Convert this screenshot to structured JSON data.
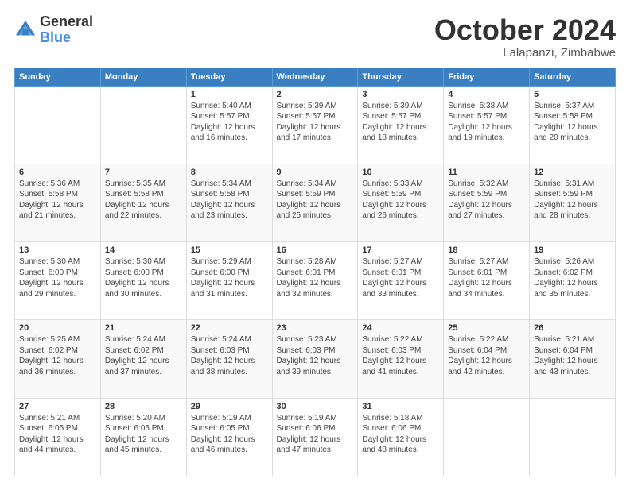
{
  "header": {
    "logo": {
      "line1": "General",
      "line2": "Blue"
    },
    "title": "October 2024",
    "location": "Lalapanzi, Zimbabwe"
  },
  "weekdays": [
    "Sunday",
    "Monday",
    "Tuesday",
    "Wednesday",
    "Thursday",
    "Friday",
    "Saturday"
  ],
  "weeks": [
    [
      {
        "day": null,
        "sunrise": null,
        "sunset": null,
        "daylight": null
      },
      {
        "day": null,
        "sunrise": null,
        "sunset": null,
        "daylight": null
      },
      {
        "day": "1",
        "sunrise": "Sunrise: 5:40 AM",
        "sunset": "Sunset: 5:57 PM",
        "daylight": "Daylight: 12 hours and 16 minutes."
      },
      {
        "day": "2",
        "sunrise": "Sunrise: 5:39 AM",
        "sunset": "Sunset: 5:57 PM",
        "daylight": "Daylight: 12 hours and 17 minutes."
      },
      {
        "day": "3",
        "sunrise": "Sunrise: 5:39 AM",
        "sunset": "Sunset: 5:57 PM",
        "daylight": "Daylight: 12 hours and 18 minutes."
      },
      {
        "day": "4",
        "sunrise": "Sunrise: 5:38 AM",
        "sunset": "Sunset: 5:57 PM",
        "daylight": "Daylight: 12 hours and 19 minutes."
      },
      {
        "day": "5",
        "sunrise": "Sunrise: 5:37 AM",
        "sunset": "Sunset: 5:58 PM",
        "daylight": "Daylight: 12 hours and 20 minutes."
      }
    ],
    [
      {
        "day": "6",
        "sunrise": "Sunrise: 5:36 AM",
        "sunset": "Sunset: 5:58 PM",
        "daylight": "Daylight: 12 hours and 21 minutes."
      },
      {
        "day": "7",
        "sunrise": "Sunrise: 5:35 AM",
        "sunset": "Sunset: 5:58 PM",
        "daylight": "Daylight: 12 hours and 22 minutes."
      },
      {
        "day": "8",
        "sunrise": "Sunrise: 5:34 AM",
        "sunset": "Sunset: 5:58 PM",
        "daylight": "Daylight: 12 hours and 23 minutes."
      },
      {
        "day": "9",
        "sunrise": "Sunrise: 5:34 AM",
        "sunset": "Sunset: 5:59 PM",
        "daylight": "Daylight: 12 hours and 25 minutes."
      },
      {
        "day": "10",
        "sunrise": "Sunrise: 5:33 AM",
        "sunset": "Sunset: 5:59 PM",
        "daylight": "Daylight: 12 hours and 26 minutes."
      },
      {
        "day": "11",
        "sunrise": "Sunrise: 5:32 AM",
        "sunset": "Sunset: 5:59 PM",
        "daylight": "Daylight: 12 hours and 27 minutes."
      },
      {
        "day": "12",
        "sunrise": "Sunrise: 5:31 AM",
        "sunset": "Sunset: 5:59 PM",
        "daylight": "Daylight: 12 hours and 28 minutes."
      }
    ],
    [
      {
        "day": "13",
        "sunrise": "Sunrise: 5:30 AM",
        "sunset": "Sunset: 6:00 PM",
        "daylight": "Daylight: 12 hours and 29 minutes."
      },
      {
        "day": "14",
        "sunrise": "Sunrise: 5:30 AM",
        "sunset": "Sunset: 6:00 PM",
        "daylight": "Daylight: 12 hours and 30 minutes."
      },
      {
        "day": "15",
        "sunrise": "Sunrise: 5:29 AM",
        "sunset": "Sunset: 6:00 PM",
        "daylight": "Daylight: 12 hours and 31 minutes."
      },
      {
        "day": "16",
        "sunrise": "Sunrise: 5:28 AM",
        "sunset": "Sunset: 6:01 PM",
        "daylight": "Daylight: 12 hours and 32 minutes."
      },
      {
        "day": "17",
        "sunrise": "Sunrise: 5:27 AM",
        "sunset": "Sunset: 6:01 PM",
        "daylight": "Daylight: 12 hours and 33 minutes."
      },
      {
        "day": "18",
        "sunrise": "Sunrise: 5:27 AM",
        "sunset": "Sunset: 6:01 PM",
        "daylight": "Daylight: 12 hours and 34 minutes."
      },
      {
        "day": "19",
        "sunrise": "Sunrise: 5:26 AM",
        "sunset": "Sunset: 6:02 PM",
        "daylight": "Daylight: 12 hours and 35 minutes."
      }
    ],
    [
      {
        "day": "20",
        "sunrise": "Sunrise: 5:25 AM",
        "sunset": "Sunset: 6:02 PM",
        "daylight": "Daylight: 12 hours and 36 minutes."
      },
      {
        "day": "21",
        "sunrise": "Sunrise: 5:24 AM",
        "sunset": "Sunset: 6:02 PM",
        "daylight": "Daylight: 12 hours and 37 minutes."
      },
      {
        "day": "22",
        "sunrise": "Sunrise: 5:24 AM",
        "sunset": "Sunset: 6:03 PM",
        "daylight": "Daylight: 12 hours and 38 minutes."
      },
      {
        "day": "23",
        "sunrise": "Sunrise: 5:23 AM",
        "sunset": "Sunset: 6:03 PM",
        "daylight": "Daylight: 12 hours and 39 minutes."
      },
      {
        "day": "24",
        "sunrise": "Sunrise: 5:22 AM",
        "sunset": "Sunset: 6:03 PM",
        "daylight": "Daylight: 12 hours and 41 minutes."
      },
      {
        "day": "25",
        "sunrise": "Sunrise: 5:22 AM",
        "sunset": "Sunset: 6:04 PM",
        "daylight": "Daylight: 12 hours and 42 minutes."
      },
      {
        "day": "26",
        "sunrise": "Sunrise: 5:21 AM",
        "sunset": "Sunset: 6:04 PM",
        "daylight": "Daylight: 12 hours and 43 minutes."
      }
    ],
    [
      {
        "day": "27",
        "sunrise": "Sunrise: 5:21 AM",
        "sunset": "Sunset: 6:05 PM",
        "daylight": "Daylight: 12 hours and 44 minutes."
      },
      {
        "day": "28",
        "sunrise": "Sunrise: 5:20 AM",
        "sunset": "Sunset: 6:05 PM",
        "daylight": "Daylight: 12 hours and 45 minutes."
      },
      {
        "day": "29",
        "sunrise": "Sunrise: 5:19 AM",
        "sunset": "Sunset: 6:05 PM",
        "daylight": "Daylight: 12 hours and 46 minutes."
      },
      {
        "day": "30",
        "sunrise": "Sunrise: 5:19 AM",
        "sunset": "Sunset: 6:06 PM",
        "daylight": "Daylight: 12 hours and 47 minutes."
      },
      {
        "day": "31",
        "sunrise": "Sunrise: 5:18 AM",
        "sunset": "Sunset: 6:06 PM",
        "daylight": "Daylight: 12 hours and 48 minutes."
      },
      {
        "day": null,
        "sunrise": null,
        "sunset": null,
        "daylight": null
      },
      {
        "day": null,
        "sunrise": null,
        "sunset": null,
        "daylight": null
      }
    ]
  ]
}
